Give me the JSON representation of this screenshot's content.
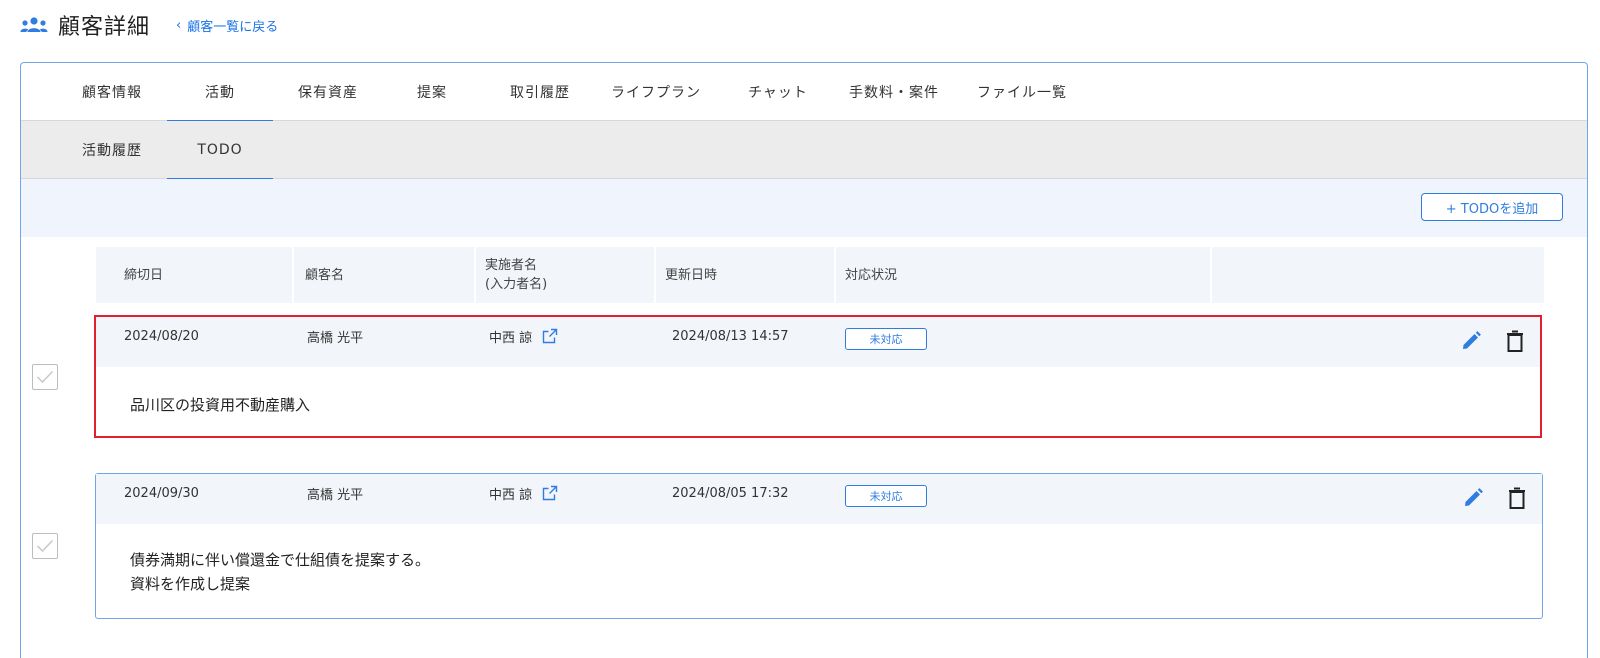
{
  "header": {
    "title": "顧客詳細",
    "back_link": "顧客一覧に戻る",
    "icon": "people-group-icon"
  },
  "tabs": [
    {
      "label": "顧客情報",
      "active": false
    },
    {
      "label": "活動",
      "active": true
    },
    {
      "label": "保有資産",
      "active": false
    },
    {
      "label": "提案",
      "active": false
    },
    {
      "label": "取引履歴",
      "active": false
    },
    {
      "label": "ライフプラン",
      "active": false
    },
    {
      "label": "チャット",
      "active": false
    },
    {
      "label": "手数料・案件",
      "active": false
    },
    {
      "label": "ファイル一覧",
      "active": false
    }
  ],
  "subtabs": [
    {
      "label": "活動履歴",
      "active": false
    },
    {
      "label": "TODO",
      "active": true
    }
  ],
  "toolbar": {
    "add_label": "+ TODOを追加"
  },
  "table": {
    "columns": [
      "締切日",
      "顧客名",
      "実施者名\n(入力者名)",
      "更新日時",
      "対応状況"
    ],
    "rows": [
      {
        "deadline": "2024/08/20",
        "customer": "高橋 光平",
        "assignee": "中西 諒",
        "updated": "2024/08/13 14:57",
        "status": "未対応",
        "body": "品川区の投資用不動産購入",
        "selected": true
      },
      {
        "deadline": "2024/09/30",
        "customer": "高橋 光平",
        "assignee": "中西 諒",
        "updated": "2024/08/05 17:32",
        "status": "未対応",
        "body": "債券満期に伴い償還金で仕組債を提案する。\n資料を作成し提案",
        "selected": false
      }
    ]
  },
  "colors": {
    "accent": "#2f7de1",
    "selection": "#e0202c",
    "header_bg": "#f2f5fa",
    "toolbar_bg": "#f0f5fd",
    "subtab_bg": "#ececec"
  }
}
